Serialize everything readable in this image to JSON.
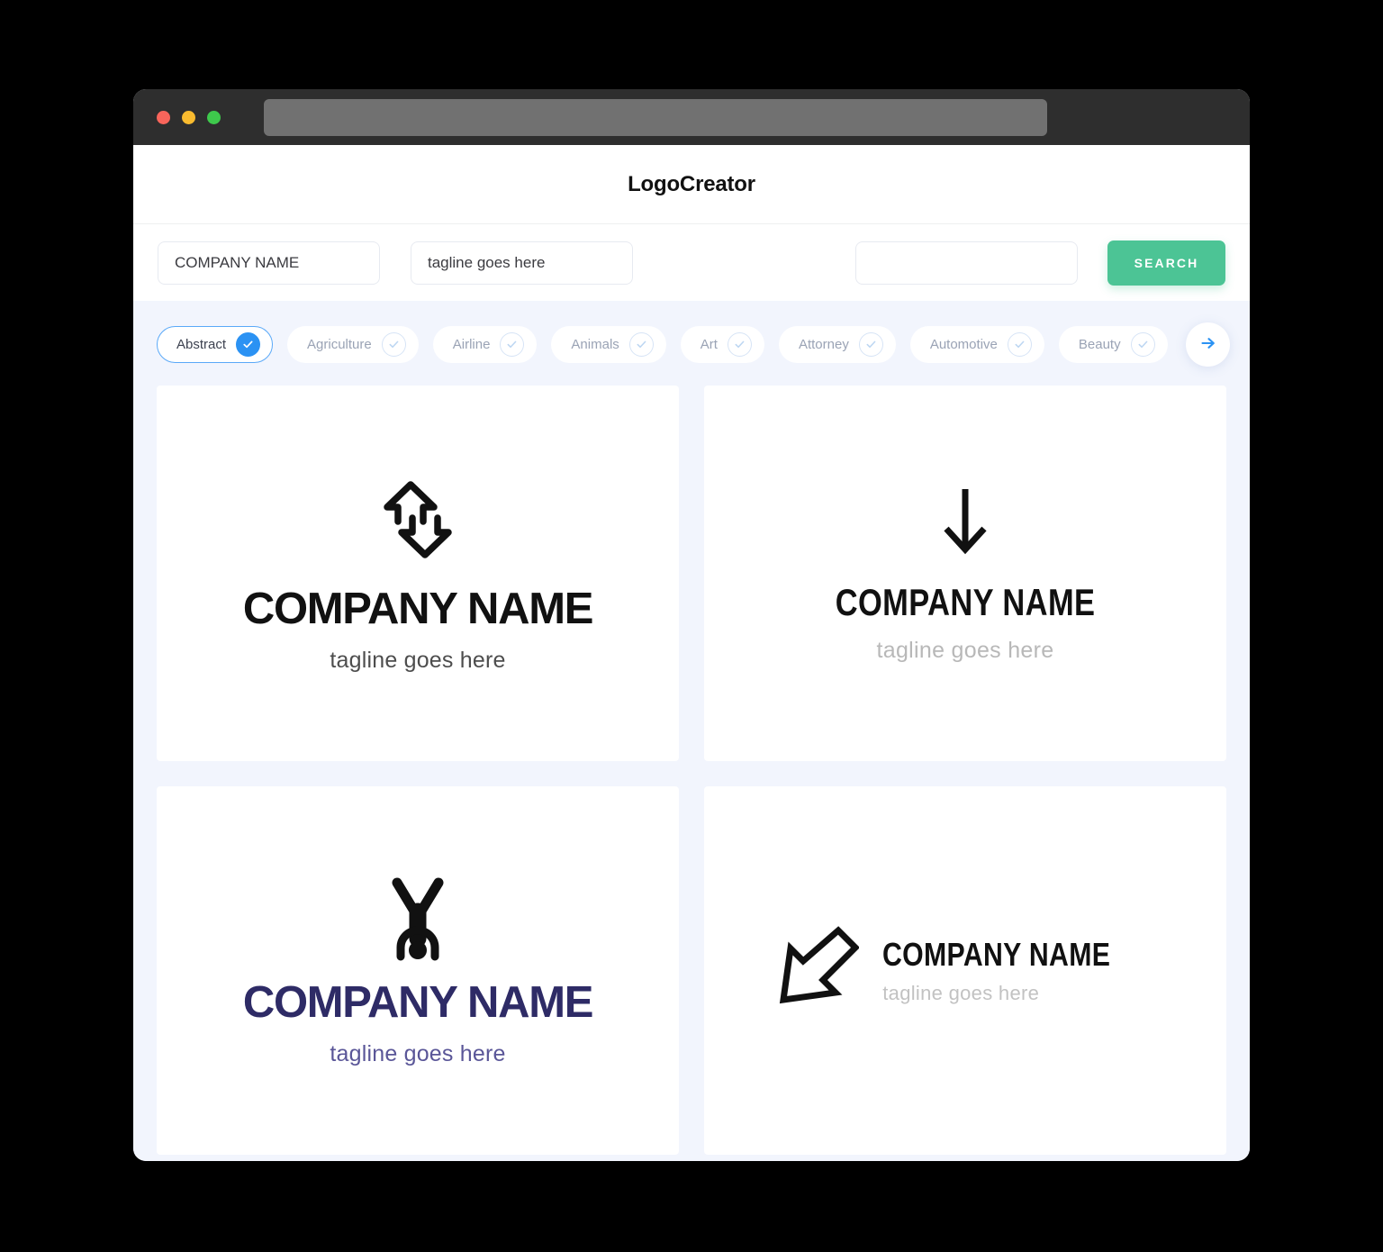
{
  "browser": {
    "traffic_lights": [
      "close-red",
      "minimize-yellow",
      "maximize-green"
    ],
    "url_value": ""
  },
  "header": {
    "brand": "LogoCreator"
  },
  "search": {
    "company_value": "COMPANY NAME",
    "company_placeholder": "COMPANY NAME",
    "tagline_value": "tagline goes here",
    "tagline_placeholder": "tagline goes here",
    "extra_value": "",
    "extra_placeholder": "",
    "search_label": "SEARCH",
    "search_color": "#4cc495"
  },
  "categories": {
    "selected_color": "#2b92f3",
    "next_label": "next-categories",
    "items": [
      {
        "label": "Abstract",
        "selected": true
      },
      {
        "label": "Agriculture",
        "selected": false
      },
      {
        "label": "Airline",
        "selected": false
      },
      {
        "label": "Animals",
        "selected": false
      },
      {
        "label": "Art",
        "selected": false
      },
      {
        "label": "Attorney",
        "selected": false
      },
      {
        "label": "Automotive",
        "selected": false
      },
      {
        "label": "Beauty",
        "selected": false
      }
    ]
  },
  "results": [
    {
      "icon": "double-arrow-up-down-outline-icon",
      "name": "COMPANY NAME",
      "tagline": "tagline goes here",
      "name_color": "#111111",
      "tagline_color": "#4d4d4d",
      "layout": "stacked"
    },
    {
      "icon": "arrow-down-icon",
      "name": "COMPANY NAME",
      "tagline": "tagline goes here",
      "name_color": "#111111",
      "tagline_color": "#b8b8b8",
      "layout": "stacked"
    },
    {
      "icon": "handstand-figure-icon",
      "name": "COMPANY NAME",
      "tagline": "tagline goes here",
      "name_color": "#2e2b66",
      "tagline_color": "#5a5698",
      "layout": "stacked"
    },
    {
      "icon": "arrow-diagonal-down-left-outline-icon",
      "name": "COMPANY NAME",
      "tagline": "tagline goes here",
      "name_color": "#111111",
      "tagline_color": "#c2c2c2",
      "layout": "horizontal"
    }
  ]
}
